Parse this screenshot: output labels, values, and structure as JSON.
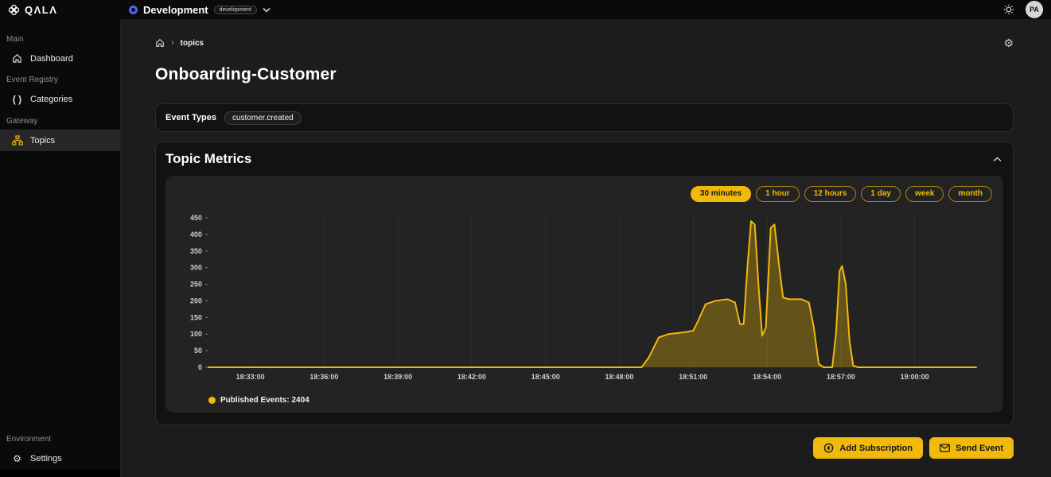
{
  "topbar": {
    "logo_text": "QΛLΛ",
    "env_name": "Development",
    "env_badge": "development",
    "avatar_initials": "PA"
  },
  "sidebar": {
    "sections": [
      {
        "label": "Main",
        "items": [
          {
            "label": "Dashboard",
            "icon": "home-icon",
            "active": false
          }
        ]
      },
      {
        "label": "Event Registry",
        "items": [
          {
            "label": "Categories",
            "icon": "code-icon",
            "active": false
          }
        ]
      },
      {
        "label": "Gateway",
        "items": [
          {
            "label": "Topics",
            "icon": "topics-icon",
            "active": true
          }
        ]
      },
      {
        "label": "Environment",
        "items": [
          {
            "label": "Settings",
            "icon": "gear-icon",
            "active": false
          }
        ]
      }
    ]
  },
  "breadcrumb": {
    "separator": "›",
    "current": "topics"
  },
  "page": {
    "title": "Onboarding-Customer"
  },
  "event_types": {
    "label": "Event Types",
    "chips": [
      "customer.created"
    ]
  },
  "metrics": {
    "title": "Topic Metrics",
    "ranges": [
      {
        "label": "30 minutes",
        "active": true
      },
      {
        "label": "1 hour",
        "active": false
      },
      {
        "label": "12 hours",
        "active": false
      },
      {
        "label": "1 day",
        "active": false
      },
      {
        "label": "week",
        "active": false
      },
      {
        "label": "month",
        "active": false
      }
    ]
  },
  "chart_data": {
    "type": "area",
    "title": "Topic Metrics",
    "legend": "Published Events: 2404",
    "x_ticks": [
      "18:33:00",
      "18:36:00",
      "18:39:00",
      "18:42:00",
      "18:45:00",
      "18:48:00",
      "18:51:00",
      "18:54:00",
      "18:57:00",
      "19:00:00"
    ],
    "x_tick_minutes": [
      3,
      6,
      9,
      12,
      15,
      18,
      21,
      24,
      27,
      30
    ],
    "xlim": [
      1.3,
      32.5
    ],
    "y_ticks": [
      0,
      50,
      100,
      150,
      200,
      250,
      300,
      350,
      400,
      450
    ],
    "ylim": [
      0,
      450
    ],
    "grid": "vertical",
    "colors": {
      "line": "#f0b90b",
      "area": "rgba(240,185,11,0.32)",
      "grid": "#2e2e2e",
      "tick_text": "#cfcfcf"
    },
    "series": [
      {
        "name": "Published Events",
        "total": 2404,
        "points": [
          [
            1.3,
            0
          ],
          [
            18.9,
            0
          ],
          [
            19.2,
            30
          ],
          [
            19.6,
            90
          ],
          [
            20.0,
            100
          ],
          [
            20.6,
            105
          ],
          [
            21.0,
            110
          ],
          [
            21.2,
            140
          ],
          [
            21.5,
            190
          ],
          [
            21.9,
            200
          ],
          [
            22.4,
            205
          ],
          [
            22.7,
            195
          ],
          [
            22.9,
            130
          ],
          [
            23.05,
            130
          ],
          [
            23.2,
            300
          ],
          [
            23.35,
            440
          ],
          [
            23.5,
            430
          ],
          [
            23.65,
            250
          ],
          [
            23.8,
            95
          ],
          [
            23.95,
            120
          ],
          [
            24.15,
            420
          ],
          [
            24.3,
            430
          ],
          [
            24.5,
            300
          ],
          [
            24.65,
            210
          ],
          [
            24.9,
            205
          ],
          [
            25.4,
            205
          ],
          [
            25.7,
            195
          ],
          [
            25.9,
            120
          ],
          [
            26.1,
            10
          ],
          [
            26.3,
            0
          ],
          [
            26.65,
            0
          ],
          [
            26.8,
            100
          ],
          [
            26.95,
            290
          ],
          [
            27.05,
            305
          ],
          [
            27.2,
            250
          ],
          [
            27.35,
            80
          ],
          [
            27.5,
            5
          ],
          [
            27.7,
            0
          ],
          [
            32.5,
            0
          ]
        ]
      }
    ]
  },
  "actions": {
    "add_subscription": "Add Subscription",
    "send_event": "Send Event"
  }
}
